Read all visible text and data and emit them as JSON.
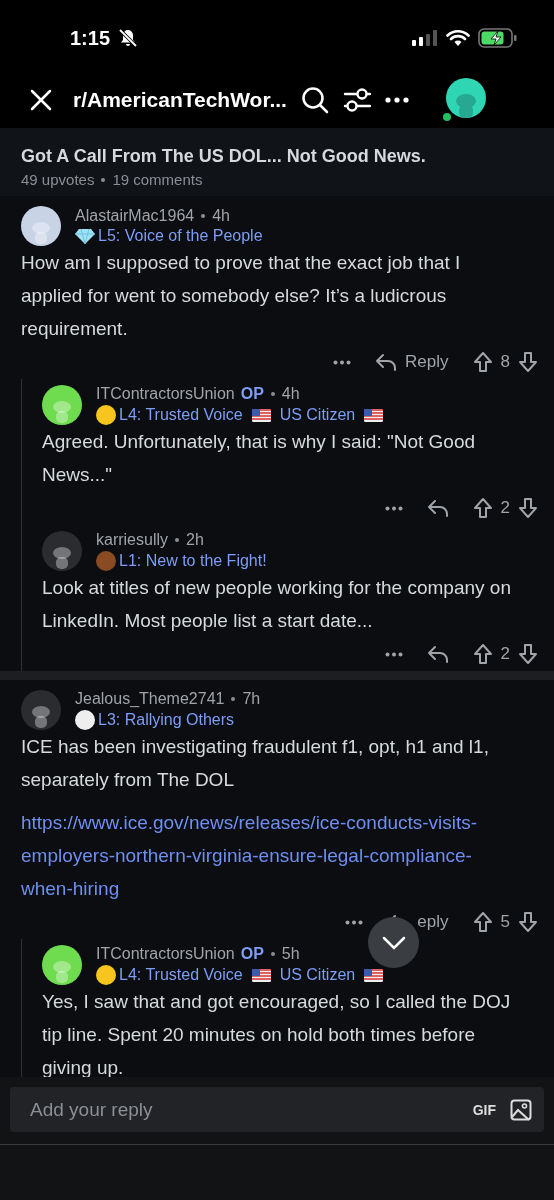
{
  "status_bar": {
    "time": "1:15"
  },
  "header": {
    "subreddit": "r/AmericanTechWor..."
  },
  "post": {
    "title": "Got A Call From The US DOL... Not Good News.",
    "upvotes": "49 upvotes",
    "comments": "19 comments"
  },
  "threads": [
    {
      "user": "AlastairMac1964",
      "age": "4h",
      "avatar": {
        "color": "#c9d3e6"
      },
      "badge": {
        "kind": "diamond"
      },
      "flair": [
        {
          "text": "L5: Voice of the People"
        }
      ],
      "body": "How am I supposed to prove that the exact job that I applied for went to somebody else? It’s a ludicrous requirement.",
      "actions": {
        "reply_label": "Reply",
        "votes": "8"
      },
      "children": [
        {
          "user": "ITContractorsUnion",
          "op": "OP",
          "age": "4h",
          "avatar": {
            "color": "#6fdc4f"
          },
          "badge": {
            "kind": "dot",
            "color": "#f7c51e"
          },
          "flair": [
            {
              "text": "L4: Trusted Voice",
              "flag": true
            },
            {
              "text": "US Citizen",
              "flag": true
            }
          ],
          "body": "Agreed. Unfortunately, that is why I said: \"Not Good News...\"",
          "actions": {
            "votes": "2"
          }
        },
        {
          "user": "karriesully",
          "age": "2h",
          "avatar": {
            "color": "#2a2c30"
          },
          "badge": {
            "kind": "dot",
            "color": "#8a4a22"
          },
          "flair": [
            {
              "text": "L1: New to the Fight!"
            }
          ],
          "body": "Look at titles of new people working for the company on LinkedIn. Most people list a start date...",
          "actions": {
            "votes": "2"
          }
        }
      ]
    },
    {
      "user": "Jealous_Theme2741",
      "age": "7h",
      "avatar": {
        "color": "#2a2c30"
      },
      "badge": {
        "kind": "dot",
        "color": "#eeeeee"
      },
      "flair": [
        {
          "text": "L3: Rallying Others"
        }
      ],
      "body": "ICE has been investigating fraudulent f1, opt, h1 and l1, separately from The DOL",
      "link": "https://www.ice.gov/news/releases/ice-conducts-visits-employers-northern-virginia-ensure-legal-compliance-when-hiring",
      "actions": {
        "reply_label": "eply",
        "votes": "5"
      },
      "children": [
        {
          "user": "ITContractorsUnion",
          "op": "OP",
          "age": "5h",
          "avatar": {
            "color": "#6fdc4f"
          },
          "badge": {
            "kind": "dot",
            "color": "#f7c51e"
          },
          "flair": [
            {
              "text": "L4: Trusted Voice",
              "flag": true
            },
            {
              "text": "US Citizen",
              "flag": true
            }
          ],
          "body": "Yes, I saw that and got encouraged, so I called the DOJ tip line. Spent 20 minutes on hold both times before giving up."
        }
      ]
    }
  ],
  "reply_bar": {
    "placeholder": "Add your reply",
    "gif": "GIF"
  }
}
